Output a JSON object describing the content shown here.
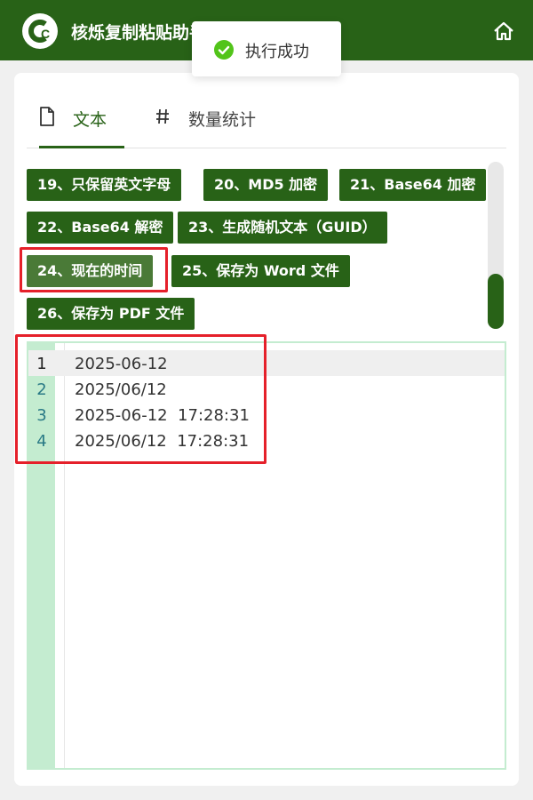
{
  "app": {
    "title": "核烁复制粘贴助手",
    "logo_text": "C"
  },
  "toast": {
    "message": "执行成功",
    "status_color": "#52c41a"
  },
  "tabs": [
    {
      "label": "文本",
      "icon": "document-icon",
      "active": true
    },
    {
      "label": "数量统计",
      "icon": "hash-icon",
      "active": false
    }
  ],
  "functions": [
    "19、只保留英文字母",
    "20、MD5 加密",
    "21、Base64 加密",
    "22、Base64 解密",
    "23、生成随机文本（GUID）",
    "24、现在的时间",
    "25、保存为 Word 文件",
    "26、保存为 PDF 文件"
  ],
  "active_function_index": 5,
  "editor": {
    "lines": [
      {
        "num": "1",
        "text": "2025-06-12"
      },
      {
        "num": "2",
        "text": "2025/06/12"
      },
      {
        "num": "3",
        "text": "2025-06-12  17:28:31"
      },
      {
        "num": "4",
        "text": "2025/06/12  17:28:31"
      }
    ]
  },
  "colors": {
    "brand": "#286217",
    "highlight": "#e5202a",
    "gutter": "#c4ecd0"
  }
}
